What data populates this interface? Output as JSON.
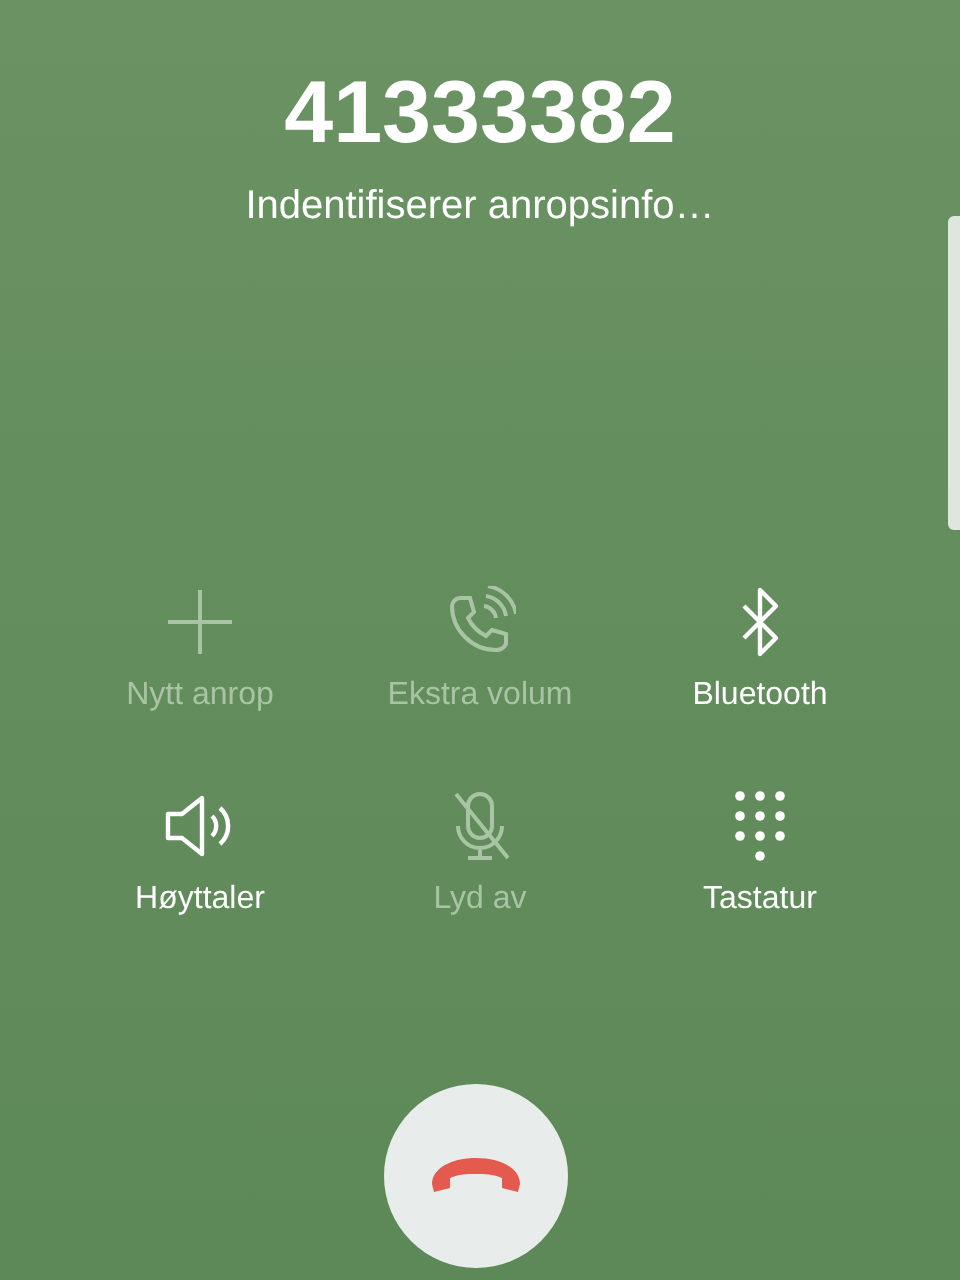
{
  "call": {
    "number": "41333382",
    "status": "Indentifiserer anropsinfo…"
  },
  "actions": [
    {
      "kind": "add",
      "label": "Nytt anrop",
      "disabled": true
    },
    {
      "kind": "volume",
      "label": "Ekstra volum",
      "disabled": true
    },
    {
      "kind": "bluetooth",
      "label": "Bluetooth",
      "disabled": false
    },
    {
      "kind": "speaker",
      "label": "Høyttaler",
      "disabled": false
    },
    {
      "kind": "mute",
      "label": "Lyd av",
      "disabled": true
    },
    {
      "kind": "keypad",
      "label": "Tastatur",
      "disabled": false
    }
  ]
}
